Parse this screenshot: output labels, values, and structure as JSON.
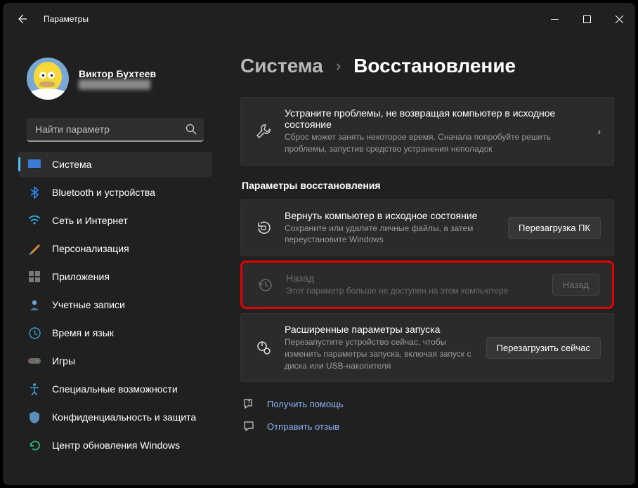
{
  "window": {
    "title": "Параметры"
  },
  "profile": {
    "name": "Виктор Бухтеев",
    "email": "████████████"
  },
  "search": {
    "placeholder": "Найти параметр"
  },
  "sidebar": {
    "items": [
      {
        "label": "Система"
      },
      {
        "label": "Bluetooth и устройства"
      },
      {
        "label": "Сеть и Интернет"
      },
      {
        "label": "Персонализация"
      },
      {
        "label": "Приложения"
      },
      {
        "label": "Учетные записи"
      },
      {
        "label": "Время и язык"
      },
      {
        "label": "Игры"
      },
      {
        "label": "Специальные возможности"
      },
      {
        "label": "Конфиденциальность и защита"
      },
      {
        "label": "Центр обновления Windows"
      }
    ]
  },
  "breadcrumb": {
    "parent": "Система",
    "current": "Восстановление"
  },
  "troubleshoot": {
    "title": "Устраните проблемы, не возвращая компьютер в исходное состояние",
    "desc": "Сброс может занять некоторое время. Сначала попробуйте решить проблемы, запустив средство устранения неполадок"
  },
  "section_title": "Параметры восстановления",
  "reset": {
    "title": "Вернуть компьютер в исходное состояние",
    "desc": "Сохраните или удалите личные файлы, а затем переустановите Windows",
    "button": "Перезагрузка ПК"
  },
  "goback": {
    "title": "Назад",
    "desc": "Этот параметр больше не доступен на этом компьютере",
    "button": "Назад"
  },
  "advanced": {
    "title": "Расширенные параметры запуска",
    "desc": "Перезапустите устройство сейчас, чтобы изменить параметры запуска, включая запуск с диска или USB-накопителя",
    "button": "Перезагрузить сейчас"
  },
  "footlinks": {
    "help": "Получить помощь",
    "feedback": "Отправить отзыв"
  }
}
